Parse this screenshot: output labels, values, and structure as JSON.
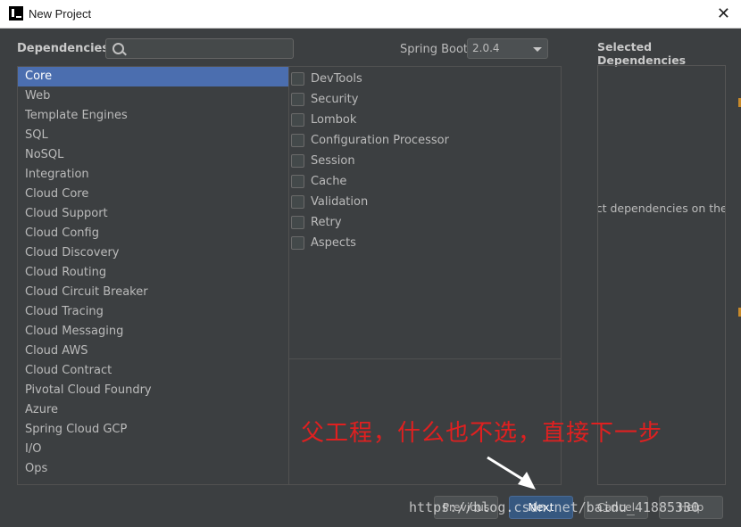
{
  "window": {
    "title": "New Project",
    "close_icon": "close-icon"
  },
  "header": {
    "dependencies_label": "Dependencies",
    "search": {
      "value": "",
      "placeholder": ""
    },
    "spring_boot_label": "Spring Boot",
    "spring_boot_version": "2.0.4",
    "selected_title": "Selected Dependencies",
    "selected_hint": "ect dependencies on the"
  },
  "categories": [
    {
      "label": "Core",
      "selected": true
    },
    {
      "label": "Web"
    },
    {
      "label": "Template Engines"
    },
    {
      "label": "SQL"
    },
    {
      "label": "NoSQL"
    },
    {
      "label": "Integration"
    },
    {
      "label": "Cloud Core"
    },
    {
      "label": "Cloud Support"
    },
    {
      "label": "Cloud Config"
    },
    {
      "label": "Cloud Discovery"
    },
    {
      "label": "Cloud Routing"
    },
    {
      "label": "Cloud Circuit Breaker"
    },
    {
      "label": "Cloud Tracing"
    },
    {
      "label": "Cloud Messaging"
    },
    {
      "label": "Cloud AWS"
    },
    {
      "label": "Cloud Contract"
    },
    {
      "label": "Pivotal Cloud Foundry"
    },
    {
      "label": "Azure"
    },
    {
      "label": "Spring Cloud GCP"
    },
    {
      "label": "I/O"
    },
    {
      "label": "Ops"
    }
  ],
  "dependencies": [
    {
      "label": "DevTools",
      "checked": false
    },
    {
      "label": "Security",
      "checked": false
    },
    {
      "label": "Lombok",
      "checked": false
    },
    {
      "label": "Configuration Processor",
      "checked": false
    },
    {
      "label": "Session",
      "checked": false
    },
    {
      "label": "Cache",
      "checked": false
    },
    {
      "label": "Validation",
      "checked": false
    },
    {
      "label": "Retry",
      "checked": false
    },
    {
      "label": "Aspects",
      "checked": false
    }
  ],
  "buttons": {
    "previous": "Previous",
    "next": "Next",
    "cancel": "Cancel",
    "help": "Help"
  },
  "annotation": "父工程，什么也不选，直接下一步",
  "watermark": "https://blog.csdn.net/baidu_41885330",
  "colors": {
    "selection": "#4b6eaf",
    "annotation": "#e02020",
    "background": "#3c3f41"
  }
}
